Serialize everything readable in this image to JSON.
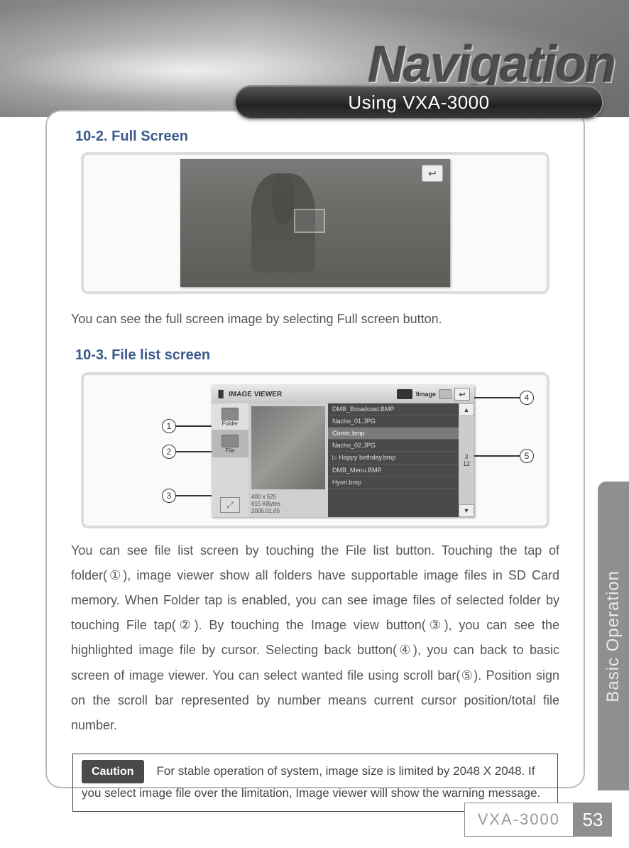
{
  "header": {
    "brand": "Navigation",
    "chapter": "Using VXA-3000"
  },
  "sections": {
    "fullscreen": {
      "heading": "10-2. Full Screen",
      "text": "You can see the full screen image by selecting Full screen button."
    },
    "filelist": {
      "heading": "10-3. File list screen",
      "text": "You can see file list screen by touching the File list button. Touching the tap of folder(①), image viewer show all folders have supportable image files in SD Card memory. When Folder tap is enabled, you can see image files of selected folder by touching File tap(②). By touching the Image view button(③), you can see the highlighted image file by cursor. Selecting back button(④), you can back to basic screen of image viewer. You can select wanted file using scroll bar(⑤). Position sign on the scroll bar represented by number means current cursor position/total file number."
    }
  },
  "image_viewer": {
    "title": "IMAGE VIEWER",
    "path_label": "\\Image",
    "side": {
      "folder": "Folder",
      "file": "File"
    },
    "meta": {
      "dims": "400 x 525",
      "size": "615 KBytes",
      "date": "2005.01.05"
    },
    "files": [
      "DMB_Broadcast.BMP",
      "Nacho_01.JPG",
      "Comic.bmp",
      "Nacho_02.JPG",
      "▷ Happy birthday.bmp",
      "DMB_Menu.BMP",
      "Hyori.bmp"
    ],
    "scroll": {
      "pos": "3",
      "total": "12"
    }
  },
  "callouts": {
    "c1": "1",
    "c2": "2",
    "c3": "3",
    "c4": "4",
    "c5": "5"
  },
  "caution": {
    "label": "Caution",
    "text": "For stable operation of system, image size is limited by 2048 X 2048. If you select image file over the limitation, Image viewer will show the warning message."
  },
  "side_tab": "Basic Operation",
  "footer": {
    "model": "VXA-3000",
    "page": "53"
  }
}
